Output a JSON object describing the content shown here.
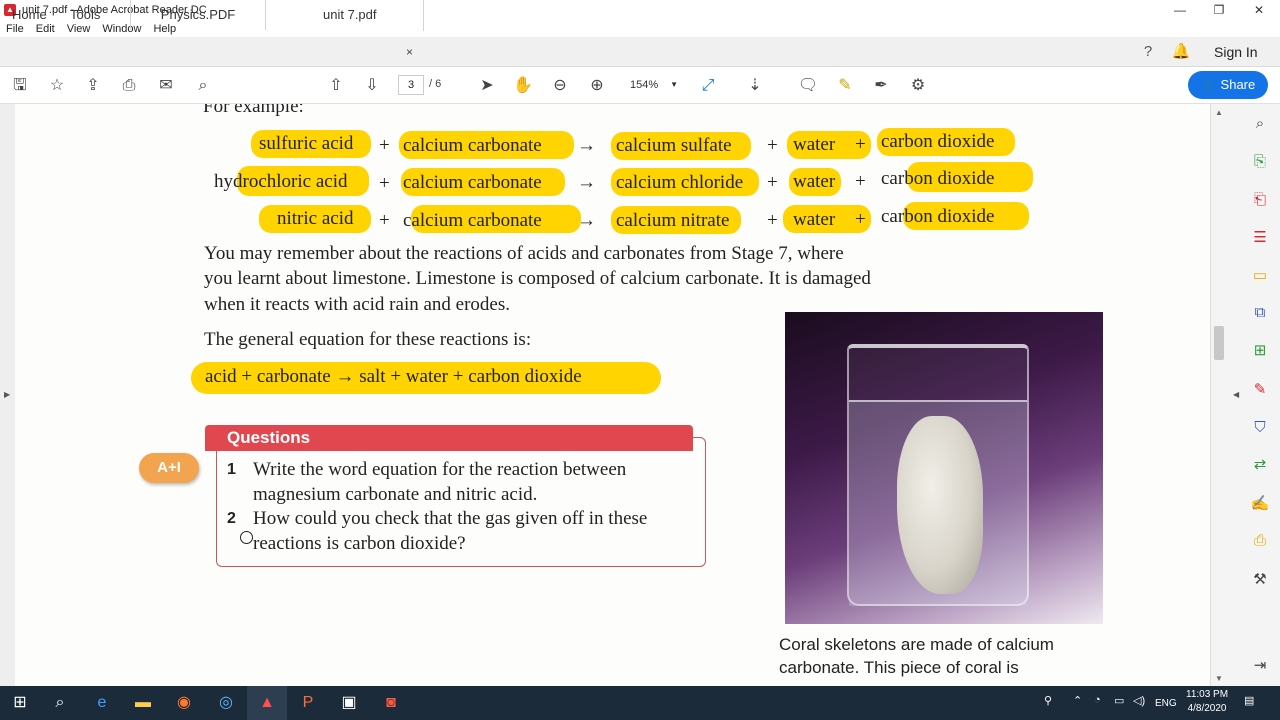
{
  "window": {
    "title": "unit 7.pdf - Adobe Acrobat Reader DC",
    "minimize": "—",
    "restore": "❐",
    "close": "✕"
  },
  "menu": [
    "File",
    "Edit",
    "View",
    "Window",
    "Help"
  ],
  "tabs": {
    "home": "Home",
    "tools": "Tools",
    "doc1": "Physics.PDF",
    "doc2": "unit 7.pdf",
    "close": "×"
  },
  "header": {
    "sign_in": "Sign In"
  },
  "toolbar": {
    "page_current": "3",
    "page_total": "/ 6",
    "zoom": "154%",
    "share": "Share"
  },
  "equations": [
    {
      "acid": "sulfuric acid",
      "carbonate": "calcium carbonate",
      "salt": "calcium sulfate",
      "water": "water",
      "gas": "carbon dioxide"
    },
    {
      "acid": "hydrochloric acid",
      "carbonate": "calcium carbonate",
      "salt": "calcium chloride",
      "water": "water",
      "gas": "carbon dioxide"
    },
    {
      "acid": "nitric acid",
      "carbonate": "calcium carbonate",
      "salt": "calcium nitrate",
      "water": "water",
      "gas": "carbon dioxide"
    }
  ],
  "symbols": {
    "plus": "+",
    "arrow": "→"
  },
  "paragraph": [
    "You may remember about the reactions of acids and carbonates from Stage 7, where",
    "you learnt about limestone. Limestone is composed of calcium carbonate. It is damaged",
    "when it reacts with acid rain and erodes."
  ],
  "general_intro": "The general equation for these reactions is:",
  "general_equation": "acid  +  carbonate  →  salt + water  +  carbon dioxide",
  "questions": {
    "heading": "Questions",
    "badge": "A+I",
    "items": [
      {
        "num": "1",
        "lines": [
          "Write the word equation for the reaction between",
          "magnesium carbonate and nitric acid."
        ]
      },
      {
        "num": "2",
        "lines": [
          "How could you check that the gas given off in these",
          "reactions is carbon dioxide?"
        ]
      }
    ]
  },
  "caption": [
    "Coral skeletons are made of calcium",
    "carbonate. This piece of coral is"
  ],
  "partial_top_text": "For example:",
  "taskbar": {
    "lang": "ENG",
    "time": "11:03 PM",
    "date": "4/8/2020"
  }
}
